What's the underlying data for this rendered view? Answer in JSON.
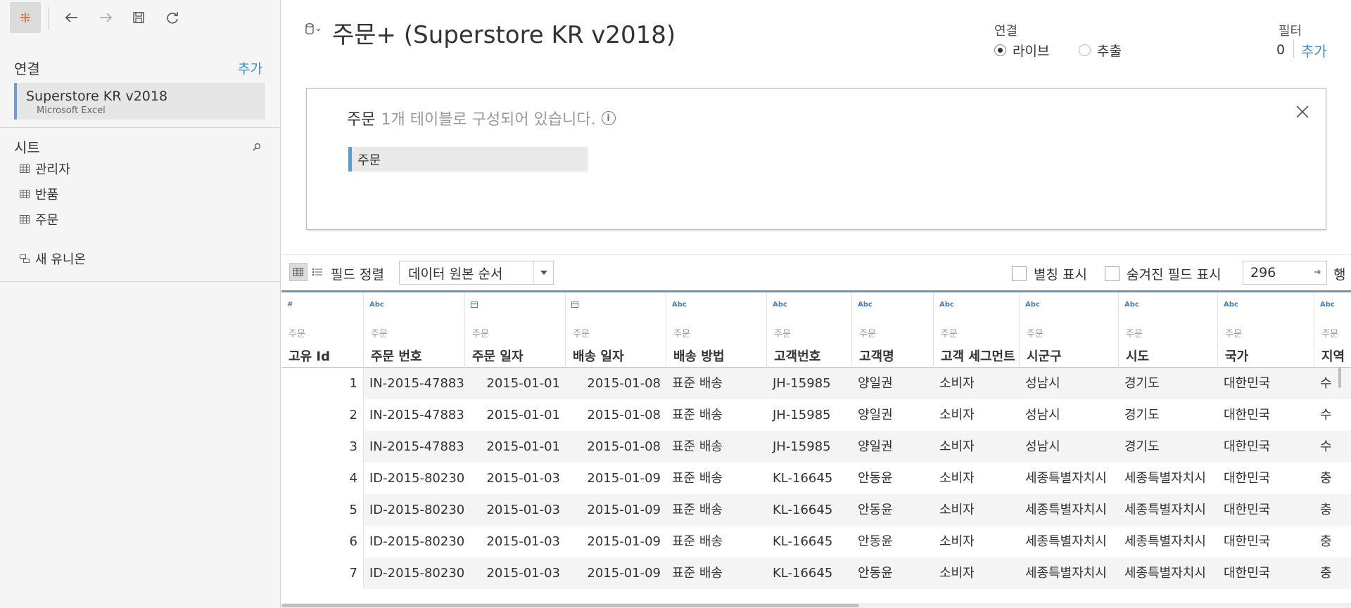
{
  "sidebar": {
    "connections_label": "연결",
    "add_label": "추가",
    "connection": {
      "name": "Superstore KR v2018",
      "type": "Microsoft Excel"
    },
    "sheets_label": "시트",
    "sheets": [
      "관리자",
      "반품",
      "주문"
    ],
    "new_union": "새 유니온"
  },
  "header": {
    "title": "주문+ (Superstore KR v2018)",
    "connection_label": "연결",
    "live_label": "라이브",
    "extract_label": "추출",
    "filters_label": "필터",
    "filter_count": "0",
    "filter_add": "추가"
  },
  "canvas": {
    "title_strong": "주문",
    "title_muted": "1개 테이블로 구성되어 있습니다.",
    "info_glyph": "i",
    "table_name": "주문"
  },
  "grid_toolbar": {
    "sort_label": "필드 정렬",
    "sort_value": "데이터 원본 순서",
    "show_aliases": "별칭 표시",
    "show_hidden": "숨겨진 필드 표시",
    "rows_value": "296",
    "rows_unit": "행"
  },
  "grid": {
    "columns": [
      {
        "type": "#",
        "source": "주문",
        "name": "고유 Id"
      },
      {
        "type": "Abc",
        "source": "주문",
        "name": "주문 번호"
      },
      {
        "type": "date",
        "source": "주문",
        "name": "주문 일자"
      },
      {
        "type": "date",
        "source": "주문",
        "name": "배송 일자"
      },
      {
        "type": "Abc",
        "source": "주문",
        "name": "배송 방법"
      },
      {
        "type": "Abc",
        "source": "주문",
        "name": "고객번호"
      },
      {
        "type": "Abc",
        "source": "주문",
        "name": "고객명"
      },
      {
        "type": "Abc",
        "source": "주문",
        "name": "고객 세그먼트"
      },
      {
        "type": "Abc",
        "source": "주문",
        "name": "시군구"
      },
      {
        "type": "Abc",
        "source": "주문",
        "name": "시도"
      },
      {
        "type": "Abc",
        "source": "주문",
        "name": "국가"
      },
      {
        "type": "Abc",
        "source": "주문",
        "name": "지역"
      }
    ],
    "rows": [
      [
        "1",
        "IN-2015-47883",
        "2015-01-01",
        "2015-01-08",
        "표준 배송",
        "JH-15985",
        "양일권",
        "소비자",
        "성남시",
        "경기도",
        "대한민국",
        "수"
      ],
      [
        "2",
        "IN-2015-47883",
        "2015-01-01",
        "2015-01-08",
        "표준 배송",
        "JH-15985",
        "양일권",
        "소비자",
        "성남시",
        "경기도",
        "대한민국",
        "수"
      ],
      [
        "3",
        "IN-2015-47883",
        "2015-01-01",
        "2015-01-08",
        "표준 배송",
        "JH-15985",
        "양일권",
        "소비자",
        "성남시",
        "경기도",
        "대한민국",
        "수"
      ],
      [
        "4",
        "ID-2015-80230",
        "2015-01-03",
        "2015-01-09",
        "표준 배송",
        "KL-16645",
        "안동윤",
        "소비자",
        "세종특별자치시",
        "세종특별자치시",
        "대한민국",
        "충"
      ],
      [
        "5",
        "ID-2015-80230",
        "2015-01-03",
        "2015-01-09",
        "표준 배송",
        "KL-16645",
        "안동윤",
        "소비자",
        "세종특별자치시",
        "세종특별자치시",
        "대한민국",
        "충"
      ],
      [
        "6",
        "ID-2015-80230",
        "2015-01-03",
        "2015-01-09",
        "표준 배송",
        "KL-16645",
        "안동윤",
        "소비자",
        "세종특별자치시",
        "세종특별자치시",
        "대한민국",
        "충"
      ],
      [
        "7",
        "ID-2015-80230",
        "2015-01-03",
        "2015-01-09",
        "표준 배송",
        "KL-16645",
        "안동윤",
        "소비자",
        "세종특별자치시",
        "세종특별자치시",
        "대한민국",
        "충"
      ]
    ]
  },
  "icons": {
    "home": "tableau-logo-icon",
    "back": "back-arrow-icon",
    "forward": "forward-arrow-icon",
    "save": "save-icon",
    "refresh": "refresh-icon"
  },
  "colors": {
    "accent": "#3d8fc4",
    "header_rule": "#5b9bd5"
  }
}
